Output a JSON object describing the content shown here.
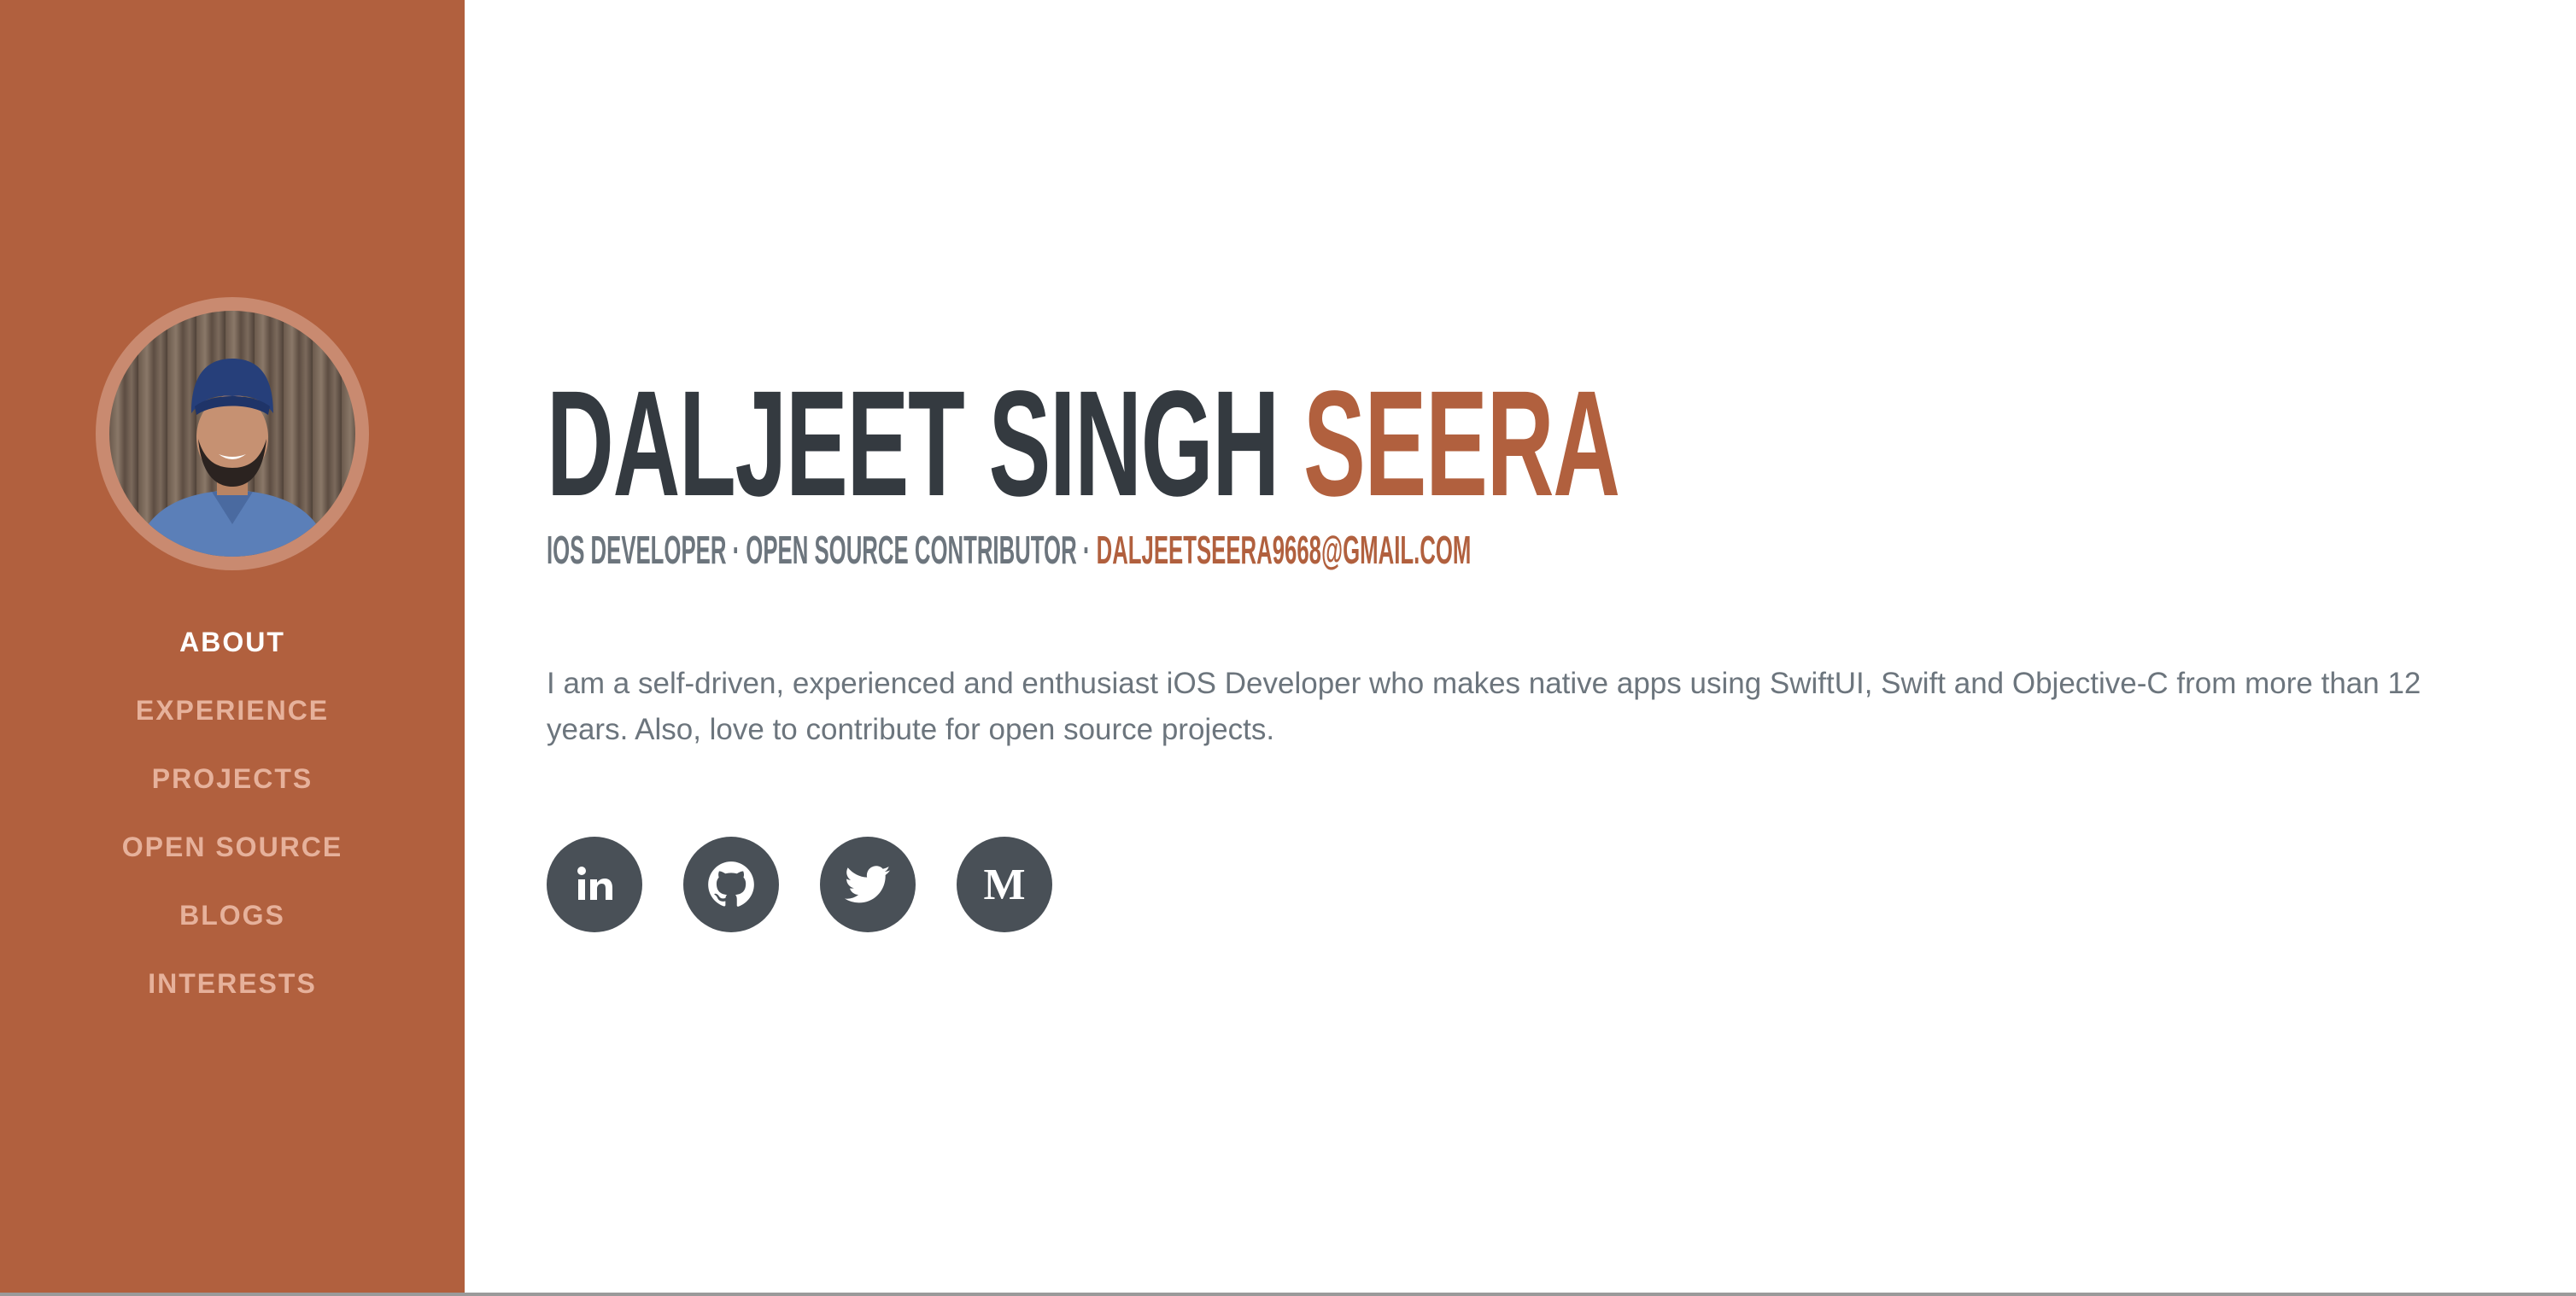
{
  "profile": {
    "name_first": "DALJEET SINGH",
    "name_last": "SEERA",
    "subheading_roles": "IOS DEVELOPER · OPEN SOURCE CONTRIBUTOR · ",
    "email": "DALJEETSEERA9668@GMAIL.COM",
    "bio": "I am a self-driven, experienced and enthusiast iOS Developer who makes native apps using SwiftUI, Swift and Objective-C from more than 12 years. Also, love to contribute for open source projects."
  },
  "nav": {
    "items": [
      {
        "label": "ABOUT",
        "active": true
      },
      {
        "label": "EXPERIENCE",
        "active": false
      },
      {
        "label": "PROJECTS",
        "active": false
      },
      {
        "label": "OPEN SOURCE",
        "active": false
      },
      {
        "label": "BLOGS",
        "active": false
      },
      {
        "label": "INTERESTS",
        "active": false
      }
    ]
  },
  "social": {
    "icons": [
      "linkedin-icon",
      "github-icon",
      "twitter-icon",
      "medium-icon"
    ],
    "linkedin_glyph": "in",
    "medium_glyph": "M"
  },
  "colors": {
    "primary": "#b1603e",
    "heading": "#343a40",
    "text": "#6c757d",
    "social_bg": "#495057",
    "nav_inactive": "#e6b19b"
  }
}
